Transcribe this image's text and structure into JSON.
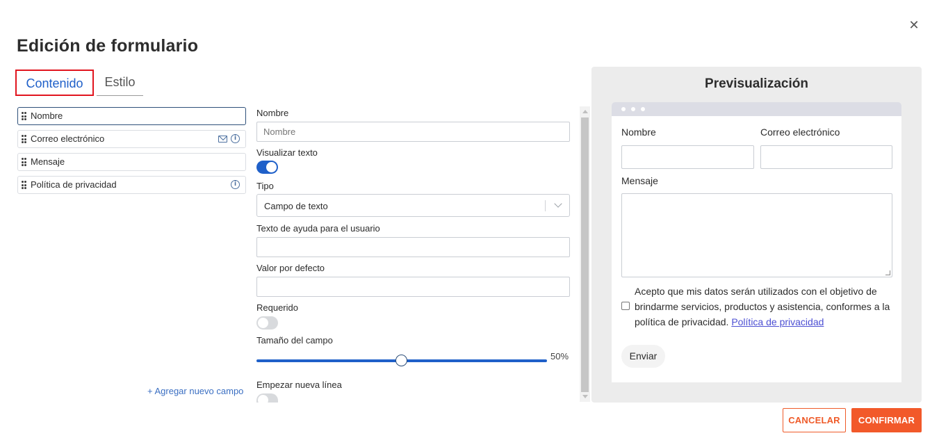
{
  "dialog": {
    "title": "Edición de formulario",
    "close_glyph": "✕"
  },
  "tabs": [
    {
      "label": "Contenido",
      "active": true
    },
    {
      "label": "Estilo",
      "active": false
    }
  ],
  "fields": [
    {
      "label": "Nombre",
      "selected": true,
      "icons": []
    },
    {
      "label": "Correo electrónico",
      "selected": false,
      "icons": [
        "mail-icon",
        "info-icon"
      ]
    },
    {
      "label": "Mensaje",
      "selected": false,
      "icons": []
    },
    {
      "label": "Política de privacidad",
      "selected": false,
      "icons": [
        "info-icon"
      ]
    }
  ],
  "add_field_label": "+ Agregar nuevo campo",
  "settings": {
    "name_label": "Nombre",
    "name_placeholder": "Nombre",
    "name_value": "",
    "show_text_label": "Visualizar texto",
    "show_text_on": true,
    "type_label": "Tipo",
    "type_value": "Campo de texto",
    "help_label": "Texto de ayuda para el usuario",
    "help_value": "",
    "default_label": "Valor por defecto",
    "default_value": "",
    "required_label": "Requerido",
    "required_on": false,
    "size_label": "Tamaño del campo",
    "size_value": "50%",
    "size_fraction": 0.5,
    "new_line_label": "Empezar nueva línea",
    "new_line_on": false
  },
  "preview": {
    "title": "Previsualización",
    "name_label": "Nombre",
    "email_label": "Correo electrónico",
    "message_label": "Mensaje",
    "consent_text": "Acepto que mis datos serán utilizados con el objetivo de brindarme servicios, productos y asistencia, conformes a la política de privacidad.",
    "consent_link": "Política de privacidad",
    "submit_label": "Enviar"
  },
  "buttons": {
    "cancel": "CANCELAR",
    "confirm": "CONFIRMAR"
  },
  "colors": {
    "accent_blue": "#1f60c9",
    "cta_orange": "#f2592a",
    "tab_highlight": "#e1141e",
    "link": "#4c4fd3"
  }
}
